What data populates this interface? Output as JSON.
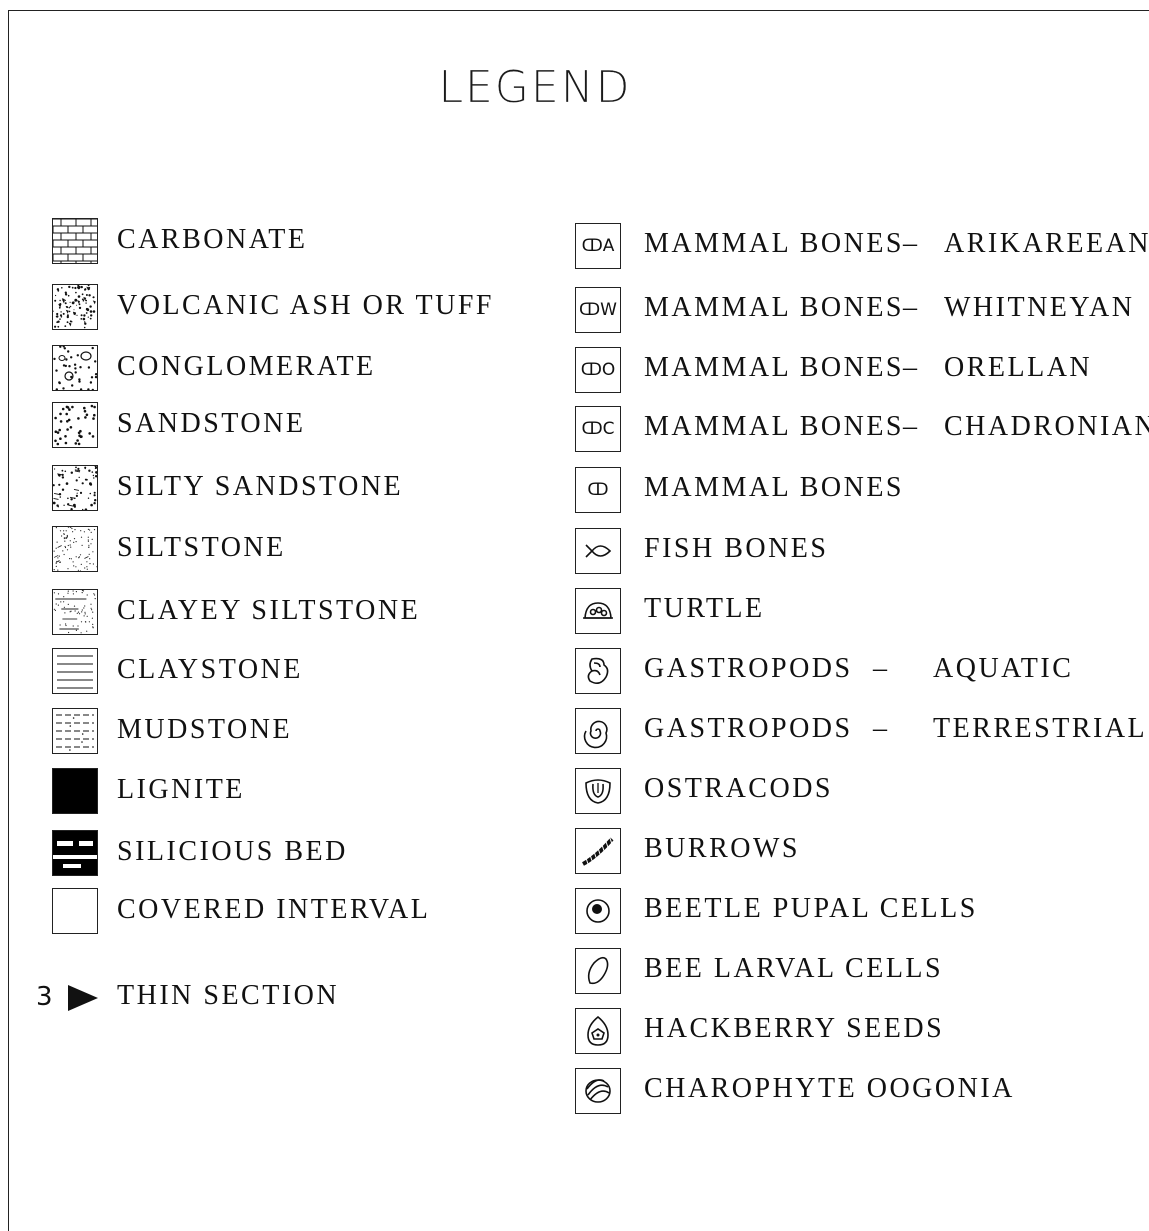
{
  "title": "LEGEND",
  "lithology": [
    {
      "label": "CARBONATE",
      "pattern": "brick-icon"
    },
    {
      "label": "VOLCANIC ASH OR TUFF",
      "pattern": "tuff-icon"
    },
    {
      "label": "CONGLOMERATE",
      "pattern": "conglomerate-icon"
    },
    {
      "label": "SANDSTONE",
      "pattern": "sandstone-icon"
    },
    {
      "label": "SILTY SANDSTONE",
      "pattern": "silty-sandstone-icon"
    },
    {
      "label": "SILTSTONE",
      "pattern": "siltstone-icon"
    },
    {
      "label": "CLAYEY SILTSTONE",
      "pattern": "clayey-siltstone-icon"
    },
    {
      "label": "CLAYSTONE",
      "pattern": "claystone-icon"
    },
    {
      "label": "MUDSTONE",
      "pattern": "mudstone-icon"
    },
    {
      "label": "LIGNITE",
      "pattern": "solid-black-icon"
    },
    {
      "label": "SILICIOUS BED",
      "pattern": "silicious-bed-icon"
    },
    {
      "label": "COVERED INTERVAL",
      "pattern": "empty-box-icon"
    }
  ],
  "thin_section": {
    "number": "3",
    "label": "THIN SECTION"
  },
  "fossils": [
    {
      "symbol": "ↀA",
      "label": "MAMMAL BONES",
      "sep": "–",
      "suffix": "ARIKAREEAN"
    },
    {
      "symbol": "ↀW",
      "label": "MAMMAL BONES",
      "sep": "–",
      "suffix": "WHITNEYAN"
    },
    {
      "symbol": "ↀO",
      "label": "MAMMAL BONES",
      "sep": "–",
      "suffix": "ORELLAN"
    },
    {
      "symbol": "ↀC",
      "label": "MAMMAL BONES",
      "sep": "–",
      "suffix": "CHADRONIAN"
    },
    {
      "symbol": "ↀ",
      "label": "MAMMAL BONES",
      "sep": "",
      "suffix": ""
    },
    {
      "symbol": "fish-icon",
      "label": "FISH BONES",
      "sep": "",
      "suffix": ""
    },
    {
      "symbol": "turtle-icon",
      "label": "TURTLE",
      "sep": "",
      "suffix": ""
    },
    {
      "symbol": "aquatic-gastropod-icon",
      "label": "GASTROPODS",
      "sep": "–",
      "suffix": "AQUATIC"
    },
    {
      "symbol": "terrestrial-gastropod-icon",
      "label": "GASTROPODS",
      "sep": "–",
      "suffix": "TERRESTRIAL"
    },
    {
      "symbol": "ostracod-icon",
      "label": "OSTRACODS",
      "sep": "",
      "suffix": ""
    },
    {
      "symbol": "burrow-icon",
      "label": "BURROWS",
      "sep": "",
      "suffix": ""
    },
    {
      "symbol": "beetle-cell-icon",
      "label": "BEETLE PUPAL CELLS",
      "sep": "",
      "suffix": ""
    },
    {
      "symbol": "bee-cell-icon",
      "label": "BEE LARVAL CELLS",
      "sep": "",
      "suffix": ""
    },
    {
      "symbol": "hackberry-icon",
      "label": "HACKBERRY SEEDS",
      "sep": "",
      "suffix": ""
    },
    {
      "symbol": "charophyte-icon",
      "label": "CHAROPHYTE OOGONIA",
      "sep": "",
      "suffix": ""
    }
  ]
}
